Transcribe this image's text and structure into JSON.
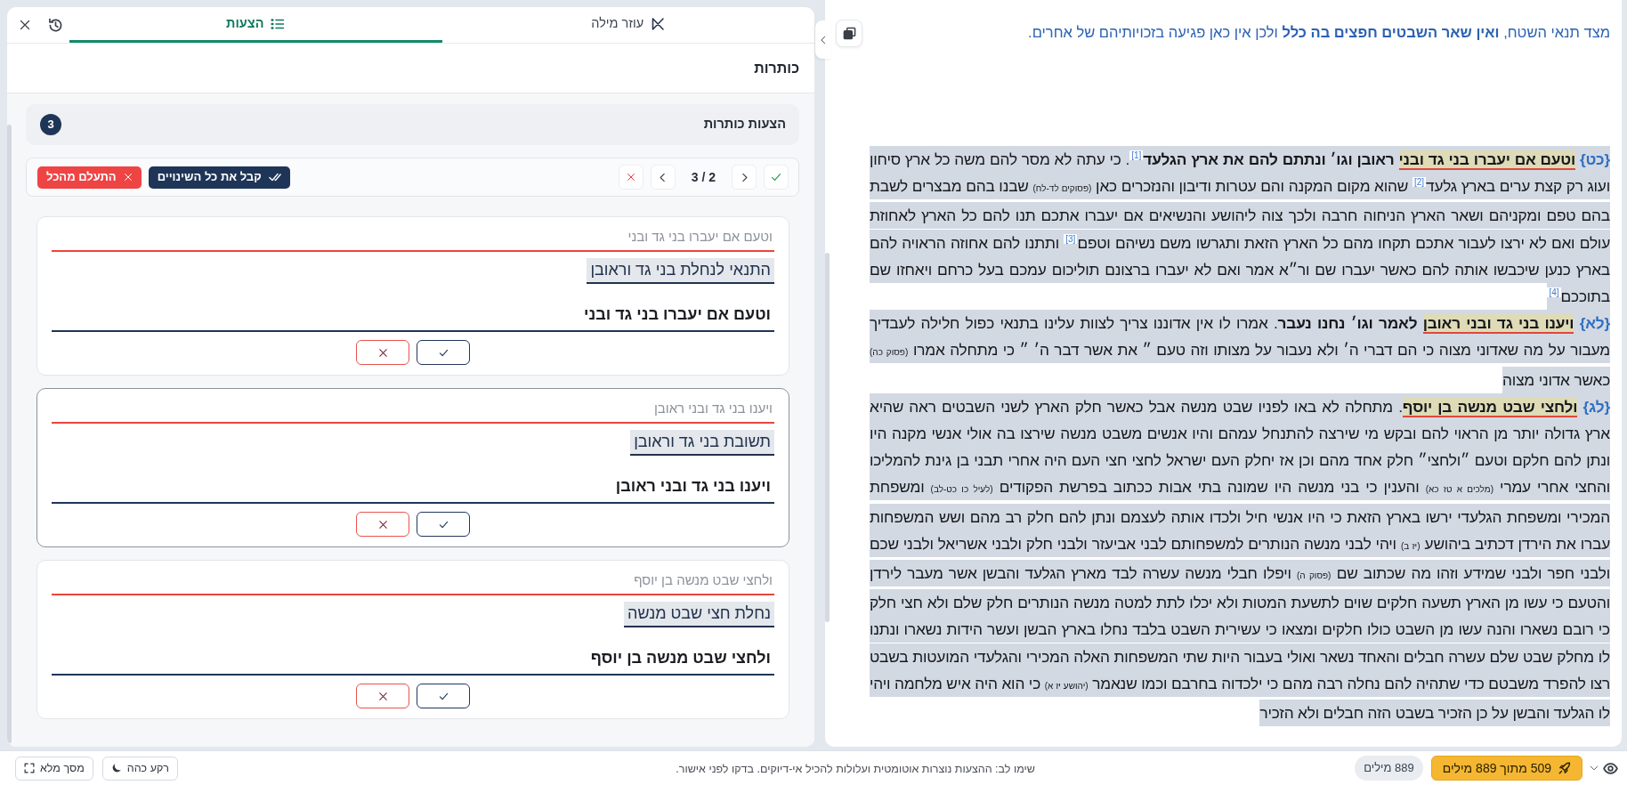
{
  "left_panel": {
    "tabs": [
      {
        "label": "עוזר מילה",
        "selected": false
      },
      {
        "label": "הצעות",
        "selected": true
      }
    ],
    "section_title": "כותרות",
    "suggestions": {
      "title": "הצעות כותרות",
      "count": "3",
      "position": "2 / 3",
      "accept_all": "קבל את כל השינויים",
      "reject_all": "התעלם מהכל",
      "items": [
        {
          "original": "וטעם אם יעברו בני גד ובני",
          "suggestion": "התנאי לנחלת בני גד וראובן",
          "value": "וטעם אם יעברו בני גד ובני",
          "selected": false
        },
        {
          "original": "ויענו בני גד ובני ראובן",
          "suggestion": "תשובת בני גד וראובן",
          "value": "ויענו בני גד ובני ראובן",
          "selected": true
        },
        {
          "original": "ולחצי שבט מנשה בן יוסף",
          "suggestion": "נחלת חצי שבט מנשה",
          "value": "ולחצי שבט מנשה בן יוסף",
          "selected": false
        }
      ]
    }
  },
  "document": {
    "paragraphs": [
      {
        "kind": "explanation",
        "selected": false,
        "segments": [
          {
            "kind": "text",
            "text": "מצד תנאי השטח, "
          },
          {
            "kind": "bold",
            "text": "ואין שאר השבטים חפצים בה כלל"
          },
          {
            "kind": "text",
            "text": " ולכן אין כאן פגיעה בזכויותיהם של אחרים."
          }
        ]
      },
      {
        "kind": "commentary",
        "selected": true,
        "segments": [
          {
            "kind": "verse",
            "text": "{כט} "
          },
          {
            "kind": "match",
            "text": "וטעם אם יעברו בני גד ובני"
          },
          {
            "kind": "bold",
            "text": " ראובן וגו׳ ונתתם להם את ארץ הגלעד"
          },
          {
            "kind": "note",
            "text": "[1]"
          },
          {
            "kind": "text",
            "text": ". כי עתה לא מסר להם משה כל ארץ סיחון ועוג רק קצת ערים בארץ גלעד"
          },
          {
            "kind": "note",
            "text": "[2]"
          },
          {
            "kind": "text",
            "text": " שהוא מקום המקנה והם עטרות ודיבון והנזכרים כאן "
          },
          {
            "kind": "ref",
            "text": "(פסוקים לד-לח)"
          },
          {
            "kind": "text",
            "text": " שבנו בהם מבצרים לשבת בהם טפם ומקניהם ושאר הארץ הניחוה חרבה ולכך צוה ליהושע והנשיאים אם יעברו אתכם תנו להם כל הארץ לאחוזת עולם ואם לא ירצו לעבור אתכם תקחו מהם כל הארץ הזאת ותגרשו משם נשיהם וטפם"
          },
          {
            "kind": "note",
            "text": "[3]"
          },
          {
            "kind": "text",
            "text": " ותתנו להם אחוזה הראויה להם בארץ כנען שיכבשו אותה להם כאשר יעברו שם ור״א אמר ואם לא יעברו ברצונם תוליכום עמכם בעל כרחם ויאחזו שם בתוככם"
          },
          {
            "kind": "note",
            "text": "[4]"
          }
        ]
      },
      {
        "kind": "commentary",
        "selected": true,
        "segments": [
          {
            "kind": "verse",
            "text": "{לא} "
          },
          {
            "kind": "match",
            "text": "ויענו בני גד ובני ראובן"
          },
          {
            "kind": "bold",
            "text": " לאמר וגו׳ נחנו נעבר"
          },
          {
            "kind": "text",
            "text": ". אמרו לו אין אדוננו צריך לצוות עלינו בתנאי כפול חלילה לעבדיך מעבור על מה שאדוני מצוה כי הם דברי ה׳ ולא נעבור על מצותו וזה טעם ״ את אשר דבר ה׳ ״ כי מתחלה אמרו "
          },
          {
            "kind": "ref",
            "text": "(פסוק כה)"
          },
          {
            "kind": "text",
            "text": " כאשר אדוני מצוה"
          }
        ]
      },
      {
        "kind": "commentary",
        "selected": true,
        "segments": [
          {
            "kind": "verse",
            "text": "{לג} "
          },
          {
            "kind": "match",
            "text": "ולחצי שבט מנשה בן יוסף"
          },
          {
            "kind": "text",
            "text": ". מתחלה לא באו לפניו שבט מנשה אבל כאשר חלק הארץ לשני השבטים ראה שהיא ארץ גדולה יותר מן הראוי להם ובקש מי שירצה להתנחל עמהם והיו אנשים משבט מנשה שירצו בה אולי אנשי מקנה היו ונתן להם חלקם וטעם ״ולחצי״ חלק אחד מהם וכן אז יחלק העם ישראל לחצי חצי העם היה אחרי תבני בן גינת להמליכו והחצי אחרי עמרי "
          },
          {
            "kind": "ref",
            "text": "(מלכים א טז כא)"
          },
          {
            "kind": "text",
            "text": " והענין כי בני מנשה היו שמונה בתי אבות ככתוב בפרשת הפקודים "
          },
          {
            "kind": "ref",
            "text": "(לעיל כו כט-לב)"
          },
          {
            "kind": "text",
            "text": " ומשפחת המכירי ומשפחת הגלעדי ירשו בארץ הזאת כי היו אנשי חיל ולכדו אותה לעצמם ונתן להם חלק רב מהם ושש המשפחות עברו את הירדן דכתיב ביהושע "
          },
          {
            "kind": "ref",
            "text": "(יז ב)"
          },
          {
            "kind": "text",
            "text": " ויהי לבני מנשה הנותרים למשפחותם לבני אביעזר ולבני חלק ולבני אשריאל ולבני שכם ולבני חפר ולבני שמידע וזהו מה שכתוב שם "
          },
          {
            "kind": "ref",
            "text": "(פסוק ה)"
          },
          {
            "kind": "text",
            "text": " ויפלו חבלי מנשה עשרה לבד מארץ הגלעד והבשן אשר מעבר לירדן והטעם כי עשו מן הארץ תשעה חלקים שוים לתשעת המטות ולא יכלו לתת למטה מנשה הנותרים חלק שלם ולא חצי חלק כי רובם נשארו והנה עשו מן השבט כולו חלקים ומצאו כי עשירית השבט בלבד נחלו בארץ הבשן ועשר הידות נשארו ונתנו לו מחלק שבט שלם עשרה חבלים והאחד נשאר ואולי בעבור היות שתי המשפחות האלה המכירי והגלעדי המועטות בשבט רצו להפרד משבטם כדי שתהיה להם נחלה רבה מהם כי ילכדוה בחרבם וכמו שנאמר "
          },
          {
            "kind": "ref",
            "text": "(יהושע יז א)"
          },
          {
            "kind": "text",
            "text": " כי הוא היה איש מלחמה ויהי לו הגלעד והבשן על כן הזכיר בשבט הזה חבלים ולא הזכיר"
          }
        ]
      }
    ]
  },
  "status_bar": {
    "fullscreen": "מסך מלא",
    "dark_mode": "רקע כהה",
    "notice": "שימו לב: ההצעות נוצרות אוטומטית ועלולות להכיל אי-דיוקים. בדקו לפני אישור.",
    "word_count": "889 מילים",
    "progress": "509 מתוך 889 מילים"
  }
}
